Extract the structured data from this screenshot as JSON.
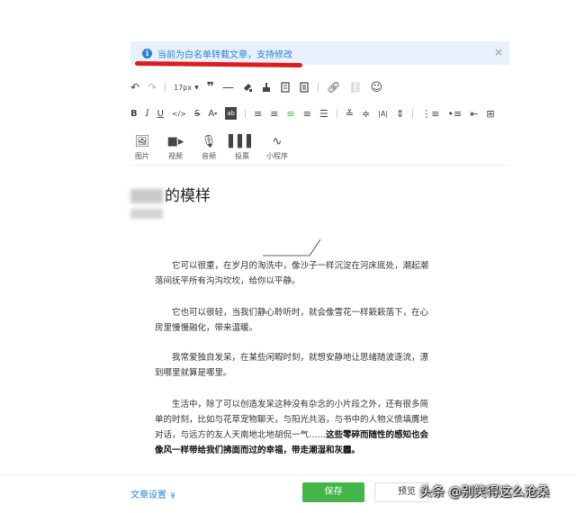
{
  "notice": {
    "text": "当前为白名单转载文章，支持修改",
    "close": "×"
  },
  "toolbar1": {
    "font_size": "17px"
  },
  "media": [
    {
      "label": "图片",
      "icon": "image-icon"
    },
    {
      "label": "视频",
      "icon": "video-icon"
    },
    {
      "label": "音频",
      "icon": "audio-icon"
    },
    {
      "label": "投票",
      "icon": "vote-icon"
    },
    {
      "label": "小程序",
      "icon": "mini-program-icon"
    }
  ],
  "article": {
    "title": "的模样",
    "paragraphs": [
      "它可以很重，在岁月的淘洗中，像沙子一样沉淀在河床底处，潮起潮落间抚平所有沟沟坎坎，给你以平静。",
      "它也可以很轻，当我们静心聆听时，就会像雪花一样簌簌落下，在心房里慢慢融化，带来温暖。",
      "我常爱独自发呆，在某些闲暇时刻，就想安静地让思绪随波逐流，漂到哪里就算是哪里。"
    ],
    "last_paragraph_normal": "生活中，除了可以创造发呆这种没有杂念的小片段之外，还有很多简单的时刻，比如与花草宠物聊天，与阳光共浴，与书中的人物义愤填膺地对话，与远方的友人天南地北地胡侃一气……",
    "last_paragraph_bold": "这些零碎而随性的感知也会像风一样带给我们拂面而过的幸福，带走潮湿和灰霾。"
  },
  "footer": {
    "settings_label": "文章设置",
    "settings_chevron": "≫",
    "save_label": "保存",
    "preview_label": "预览"
  },
  "watermark": "头条 @别笑得这么沧桑",
  "colors": {
    "accent": "#2782d7",
    "save_green": "#44b549",
    "notice_bg": "#e8f1fb",
    "highlight": "#e01b1b"
  }
}
